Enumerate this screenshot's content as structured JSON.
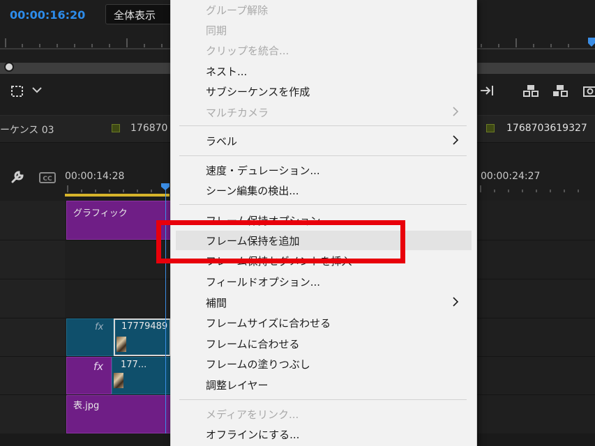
{
  "header": {
    "timecode": "00:00:16:20",
    "zoom_value": "全体表示"
  },
  "sequence": {
    "tab_label": "ーケンス 03",
    "clip_label_1": "176870",
    "clip_label_2": "1768703619327"
  },
  "timeline": {
    "time_label_1": "00:00:14:28",
    "time_label_2": "00:00:24:27",
    "clips": {
      "graphic": "グラフィック",
      "video_1": "17779489",
      "video_2": "177...",
      "image": "表.jpg",
      "fx_label": "fx"
    }
  },
  "context_menu": {
    "items": [
      {
        "label": "グループ解除",
        "enabled": false
      },
      {
        "label": "同期",
        "enabled": false
      },
      {
        "label": "クリップを統合...",
        "enabled": false
      },
      {
        "label": "ネスト...",
        "enabled": true
      },
      {
        "label": "サブシーケンスを作成",
        "enabled": true
      },
      {
        "label": "マルチカメラ",
        "enabled": false,
        "submenu": true
      },
      {
        "label": "ラベル",
        "enabled": true,
        "submenu": true
      },
      {
        "label": "速度・デュレーション...",
        "enabled": true
      },
      {
        "label": "シーン編集の検出...",
        "enabled": true
      },
      {
        "label": "フレーム保持オプション...",
        "enabled": true
      },
      {
        "label": "フレーム保持を追加",
        "enabled": true,
        "hovered": true
      },
      {
        "label": "フレーム保持セグメントを挿入",
        "enabled": true
      },
      {
        "label": "フィールドオプション...",
        "enabled": true
      },
      {
        "label": "補間",
        "enabled": true,
        "submenu": true
      },
      {
        "label": "フレームサイズに合わせる",
        "enabled": true
      },
      {
        "label": "フレームに合わせる",
        "enabled": true
      },
      {
        "label": "フレームの塗りつぶし",
        "enabled": true
      },
      {
        "label": "調整レイヤー",
        "enabled": true
      },
      {
        "label": "メディアをリンク...",
        "enabled": false
      },
      {
        "label": "オフラインにする...",
        "enabled": true
      }
    ]
  },
  "colors": {
    "accent_blue": "#2d8ceb",
    "highlight_red": "#e8000b",
    "clip_purple": "#6f1e86",
    "clip_teal": "#0f4f6b"
  }
}
